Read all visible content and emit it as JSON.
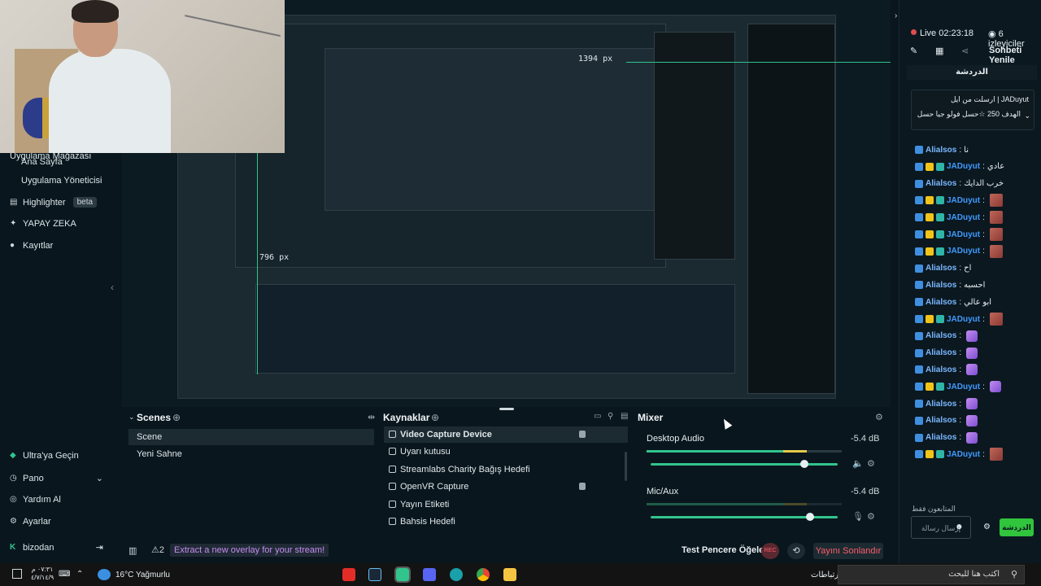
{
  "webcam": {},
  "sidebar": {
    "top_items": [
      {
        "label": "Uygulama Mağazası"
      },
      {
        "label": "Ana Sayfa"
      },
      {
        "label": "Uygulama Yöneticisi"
      }
    ],
    "highlighter": {
      "label": "Highlighter",
      "badge": "beta"
    },
    "ai": {
      "label": "YAPAY ZEKA"
    },
    "recordings": {
      "label": "Kayıtlar"
    },
    "ultra": {
      "label": "Ultra'ya Geçin"
    },
    "pano": {
      "label": "Pano"
    },
    "help": {
      "label": "Yardım Al"
    },
    "settings": {
      "label": "Ayarlar"
    },
    "user": {
      "label": "bizodan"
    }
  },
  "preview": {
    "px_w": "1394 px",
    "px_h": "796 px"
  },
  "scenes": {
    "title": "Scenes",
    "items": [
      {
        "label": "Scene",
        "selected": true
      },
      {
        "label": "Yeni Sahne",
        "selected": false
      }
    ]
  },
  "sources": {
    "title": "Kaynaklar",
    "items": [
      {
        "label": "Video Capture Device",
        "selected": true,
        "locked": true
      },
      {
        "label": "Uyarı kutusu"
      },
      {
        "label": "Streamlabs Charity Bağış Hedefi"
      },
      {
        "label": "OpenVR Capture",
        "locked": true
      },
      {
        "label": "Yayın Etiketi"
      },
      {
        "label": "Bahsis Hedefi"
      }
    ]
  },
  "mixer": {
    "title": "Mixer",
    "channels": [
      {
        "name": "Desktop Audio",
        "db": "-5.4 dB",
        "level": 0.82
      },
      {
        "name": "Mic/Aux",
        "db": "-5.4 dB",
        "level": 0.85
      }
    ]
  },
  "statusbar": {
    "alert_count": "2",
    "overlay_link": "Extract a new overlay for your stream!",
    "test_label": "Test Pencere Öğeleri",
    "rec_label": "REC",
    "go_live": "Yayını Sonlandır"
  },
  "chat": {
    "live": "Live 02:23:18",
    "viewers": "6 izleyiciler",
    "refresh": "Sohbeti Yenile",
    "tab": "الدردشة",
    "pinned": "ارسلت من ایل | JADuyut",
    "pinned_2": "الهدف 250 ☆حسل فولو جيا حسل",
    "rows": [
      {
        "user": "Alialsos",
        "msg": "نا",
        "type": "a"
      },
      {
        "user": "JADuyut",
        "msg": "عادي",
        "type": "j"
      },
      {
        "user": "Alialsos",
        "msg": "خرب الدايك",
        "type": "a"
      },
      {
        "user": "JADuyut",
        "msg": "",
        "type": "j",
        "emote": "r"
      },
      {
        "user": "JADuyut",
        "msg": "",
        "type": "j",
        "emote": "r"
      },
      {
        "user": "JADuyut",
        "msg": "",
        "type": "j",
        "emote": "r"
      },
      {
        "user": "JADuyut",
        "msg": "",
        "type": "j",
        "emote": "r"
      },
      {
        "user": "Alialsos",
        "msg": "اح",
        "type": "a"
      },
      {
        "user": "Alialsos",
        "msg": "احسبه",
        "type": "a"
      },
      {
        "user": "Alialsos",
        "msg": "ابو عالي",
        "type": "a"
      },
      {
        "user": "JADuyut",
        "msg": "",
        "type": "j",
        "emote": "r"
      },
      {
        "user": "Alialsos",
        "msg": "",
        "type": "a",
        "emote": "p"
      },
      {
        "user": "Alialsos",
        "msg": "",
        "type": "a",
        "emote": "p"
      },
      {
        "user": "Alialsos",
        "msg": "",
        "type": "a",
        "emote": "p"
      },
      {
        "user": "JADuyut",
        "msg": "",
        "type": "j",
        "emote": "p"
      },
      {
        "user": "Alialsos",
        "msg": "",
        "type": "a",
        "emote": "p"
      },
      {
        "user": "Alialsos",
        "msg": "",
        "type": "a",
        "emote": "p"
      },
      {
        "user": "Alialsos",
        "msg": "",
        "type": "a",
        "emote": "p"
      },
      {
        "user": "JADuyut",
        "msg": "",
        "type": "j",
        "emote": "r"
      }
    ],
    "footer_note": "المتابعون فقط",
    "input_placeholder": "إرسال رسالة",
    "send": "الدردشة"
  },
  "taskbar": {
    "time": "٠٧:٣١ م",
    "date": "٤/٧/١٤/٩",
    "weather": "16°C Yağmurlu",
    "lang": "ارتباطات",
    "search": "اكتب هنا للبحث"
  }
}
